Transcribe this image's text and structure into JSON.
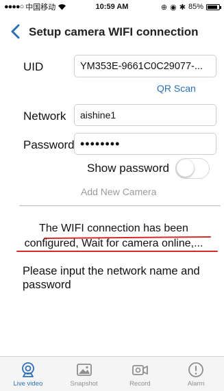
{
  "status_bar": {
    "carrier": "中国移动",
    "time": "10:59 AM",
    "battery": "85%",
    "battery_level": 0.85
  },
  "nav": {
    "title": "Setup camera WIFI connection"
  },
  "form": {
    "uid_label": "UID",
    "uid_value": "YM353E-9661C0C29077-...",
    "qr_scan": "QR Scan",
    "network_label": "Network",
    "network_value": "aishine1",
    "password_label": "Password",
    "password_value": "••••••••",
    "show_password_label": "Show password",
    "show_password_on": false,
    "add_camera": "Add New Camera"
  },
  "status_message": {
    "line1": "The WIFI connection has been",
    "line2": "configured, Wait for camera online,..."
  },
  "instruction": "Please input the network name and password",
  "tabs": [
    {
      "label": "Live video",
      "icon": "webcam-icon",
      "active": true
    },
    {
      "label": "Snapshot",
      "icon": "image-icon",
      "active": false
    },
    {
      "label": "Record",
      "icon": "video-camera-icon",
      "active": false
    },
    {
      "label": "Alarm",
      "icon": "alert-icon",
      "active": false
    }
  ],
  "colors": {
    "accent": "#2b6fb6",
    "underline": "#d62a2a",
    "hint": "#9a9a9a"
  }
}
